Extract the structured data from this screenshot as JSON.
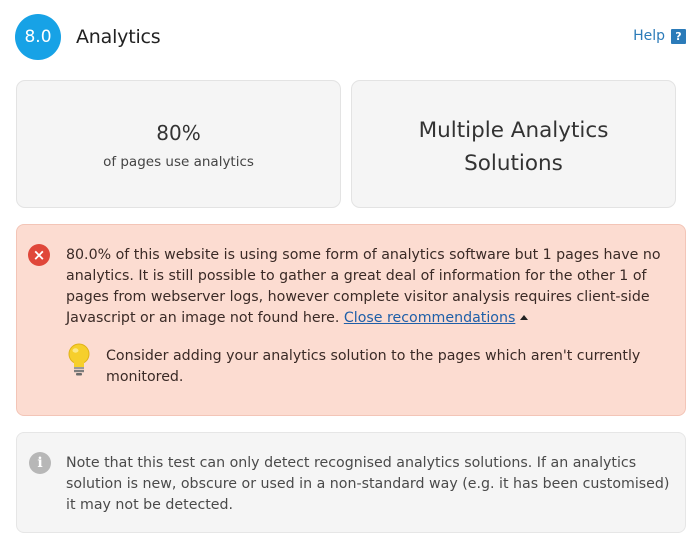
{
  "header": {
    "score": "8.0",
    "title": "Analytics",
    "help_label": "Help",
    "help_icon_glyph": "?"
  },
  "stats": {
    "percent_value": "80%",
    "percent_caption": "of pages use analytics",
    "solutions_label": "Multiple Analytics Solutions"
  },
  "error_panel": {
    "icon": "error-x-icon",
    "icon_glyph": "×",
    "message": "80.0% of this website is using some form of analytics software but 1 pages have no analytics. It is still possible to gather a great deal of information for the other 1 of pages from webserver logs, however complete visitor analysis requires client-side Javascript or an image not found here.",
    "close_link_label": "Close recommendations",
    "tip_icon": "lightbulb-icon",
    "tip": "Consider adding your analytics solution to the pages which aren't currently monitored."
  },
  "info_panel": {
    "icon": "info-icon",
    "icon_glyph": "i",
    "message": "Note that this test can only detect recognised analytics solutions. If an analytics solution is new, obscure or used in a non-standard way (e.g. it has been customised) it may not be detected."
  },
  "colors": {
    "accent": "#17a2e6",
    "link": "#2b7bb9",
    "error_bg": "#fcdcd1",
    "error_icon": "#e0473a",
    "card_bg": "#f5f5f5",
    "info_icon": "#b7b7b7"
  }
}
